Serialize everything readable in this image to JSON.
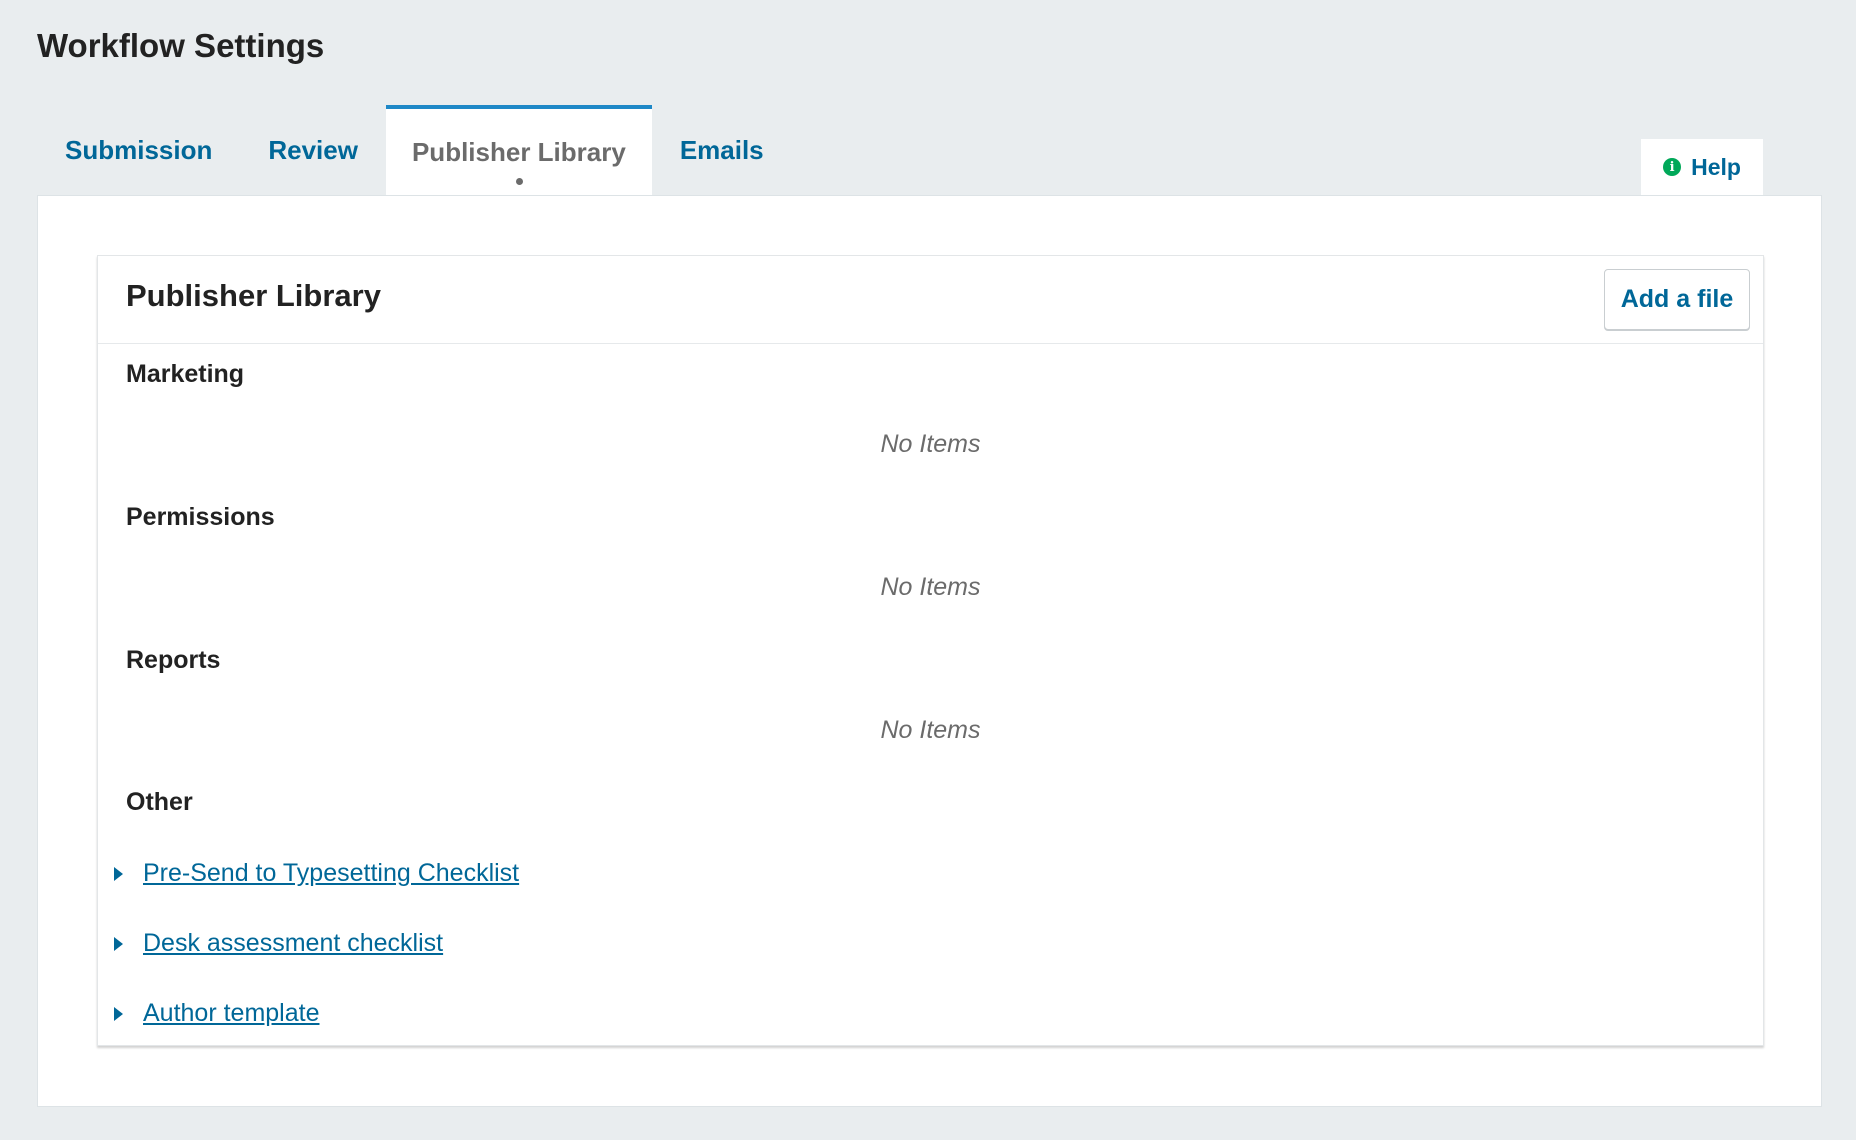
{
  "page": {
    "title": "Workflow Settings"
  },
  "tabs": [
    {
      "label": "Submission",
      "active": false
    },
    {
      "label": "Review",
      "active": false
    },
    {
      "label": "Publisher Library",
      "active": true
    },
    {
      "label": "Emails",
      "active": false
    }
  ],
  "help": {
    "label": "Help",
    "icon": "info-circle-icon"
  },
  "library": {
    "title": "Publisher Library",
    "add_button": "Add a file",
    "categories": [
      {
        "name": "Marketing",
        "empty_text": "No Items"
      },
      {
        "name": "Permissions",
        "empty_text": "No Items"
      },
      {
        "name": "Reports",
        "empty_text": "No Items"
      },
      {
        "name": "Other",
        "empty_text": ""
      }
    ],
    "files": [
      {
        "name": "Pre-Send to Typesetting Checklist"
      },
      {
        "name": "Desk assessment checklist"
      },
      {
        "name": "Author template"
      }
    ]
  },
  "colors": {
    "link": "#006798",
    "active_tab_border": "#1e88c7",
    "help_icon": "#00a859",
    "page_background": "#e9edef"
  }
}
